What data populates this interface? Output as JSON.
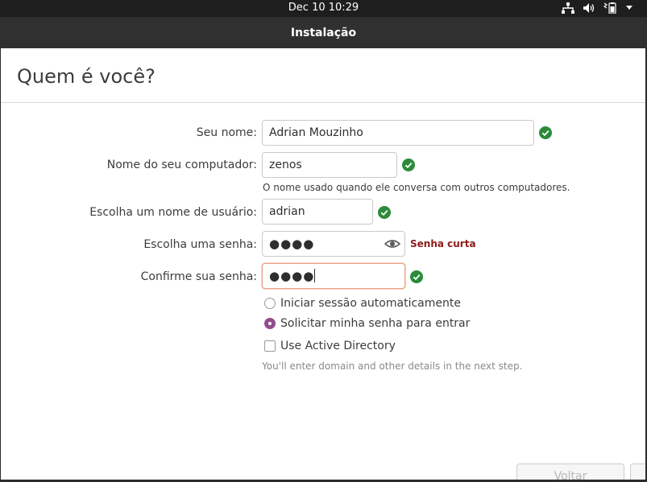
{
  "system_bar": {
    "clock": "Dec 10  10:29"
  },
  "window": {
    "title": "Instalação"
  },
  "page": {
    "heading": "Quem é você?"
  },
  "form": {
    "name": {
      "label": "Seu nome:",
      "value": "Adrian Mouzinho"
    },
    "computer": {
      "label": "Nome do seu computador:",
      "value": "zenos",
      "hint": "O nome usado quando ele conversa com outros computadores."
    },
    "username": {
      "label": "Escolha um nome de usuário:",
      "value": "adrian"
    },
    "password": {
      "label": "Escolha uma senha:",
      "masked": "●●●●",
      "strength": "Senha curta"
    },
    "confirm": {
      "label": "Confirme sua senha:",
      "masked": "●●●●"
    },
    "login_options": [
      {
        "label": "Iniciar sessão automaticamente",
        "selected": false
      },
      {
        "label": "Solicitar minha senha para entrar",
        "selected": true
      }
    ],
    "active_directory": {
      "label": "Use Active Directory",
      "checked": false,
      "hint": "You'll enter domain and other details in the next step."
    }
  },
  "buttons": {
    "back": "Voltar"
  },
  "colors": {
    "accent": "#924d8b",
    "valid": "#2a8c3a",
    "warning": "#8f1a1a",
    "focus_border": "#e9a084"
  },
  "icons": [
    "network-icon",
    "volume-icon",
    "battery-icon",
    "check-icon",
    "eye-icon"
  ]
}
